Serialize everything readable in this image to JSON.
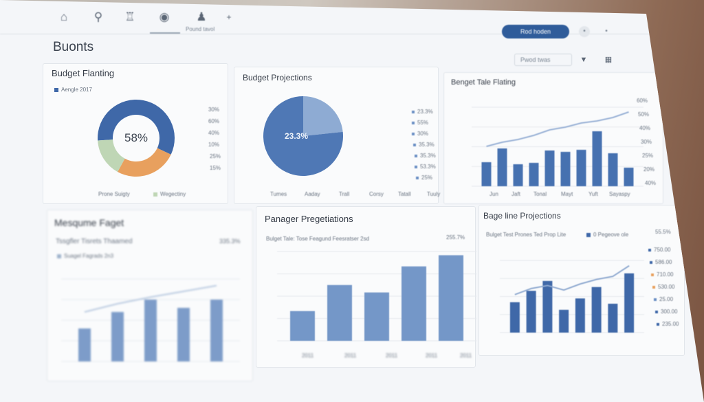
{
  "page": {
    "title": "Buonts"
  },
  "topbar": {
    "icons": [
      "home-icon",
      "search-icon",
      "users-icon",
      "dollar-icon",
      "person-icon",
      "plus-icon"
    ],
    "tab_label": "Pound tavol",
    "primary_button": "Rod hoden",
    "filter_placeholder": "Pwod twas"
  },
  "panels": {
    "budget_planning": {
      "title": "Budget Flanting",
      "legend": "Aengle 2017",
      "center_label": "58%",
      "right_labels": [
        "30%",
        "60%",
        "40%",
        "10%",
        "25%",
        "15%"
      ],
      "footer_legend": [
        "Prone Suigty",
        "Wegectiny"
      ],
      "colors": {
        "blue": "#3f68a8",
        "orange": "#e8a05e",
        "green": "#bfd6b5"
      }
    },
    "budget_projections": {
      "title": "Budget Projections",
      "center_label": "23.3%",
      "right_labels": [
        "23.3%",
        "55%",
        "30%",
        "35.3%",
        "35.3%",
        "53.3%",
        "25%"
      ],
      "x_labels": [
        "Tumes",
        "Aaday",
        "Trall",
        "Corsy",
        "Tatall",
        "Tuuly"
      ]
    },
    "budget_tale_planting": {
      "title": "Benget Tale Flating",
      "right_labels": [
        "60%",
        "50%",
        "40%",
        "30%",
        "25%",
        "20%",
        "40%"
      ],
      "x_labels": [
        "Jun",
        "Jaft",
        "Tonal",
        "Mayt",
        "Yuft",
        "Sayaspy"
      ]
    },
    "measure_target": {
      "title": "Mesqume Faget",
      "subtitle": "Tssgfler Tisrets Thaamed",
      "value": "335.3%",
      "legend": "Suagel Fagrads 2n3"
    },
    "manager_projections": {
      "title": "Panager Pregetiations",
      "subtitle": "Bulget Tale: Tose Feagund Feesratser 2sd",
      "value": "255.7%",
      "x_labels": [
        "2011",
        "2011",
        "2011",
        "2011",
        "2011"
      ]
    },
    "baseline_projections": {
      "title": "Bage line Projections",
      "subtitle": "Bulget Test Prones Ted Prop Lite",
      "legend": "0 Pegeove ole",
      "value": "55.5%",
      "right_labels": [
        "750.00",
        "586.00",
        "710.00",
        "530.00",
        "25.00",
        "300.00",
        "235.00"
      ]
    }
  },
  "chart_data": [
    {
      "type": "pie",
      "title": "Budget Flanting",
      "values": [
        58,
        26,
        16
      ],
      "colors": [
        "#3f68a8",
        "#e8a05e",
        "#bfd6b5"
      ],
      "center_label": "58%"
    },
    {
      "type": "pie",
      "title": "Budget Projections",
      "values": [
        23.3,
        76.7
      ],
      "colors": [
        "#8eabd3",
        "#4f78b5"
      ],
      "center_label": "23.3%"
    },
    {
      "type": "bar",
      "title": "Benget Tale Flating",
      "categories": [
        "Jun",
        "Jaft",
        "Tonal",
        "Mayt",
        "Yuft",
        "Sayaspy"
      ],
      "values": [
        35,
        55,
        32,
        34,
        52,
        50,
        53,
        80,
        48,
        27
      ],
      "line": [
        58,
        64,
        68,
        74,
        82,
        86,
        92,
        95,
        100,
        108
      ]
    },
    {
      "type": "bar",
      "title": "Mesqume Faget",
      "values": [
        40,
        60,
        75,
        65,
        75
      ],
      "line": [
        60,
        70,
        78,
        85,
        92
      ]
    },
    {
      "type": "bar",
      "title": "Panager Pregetiations",
      "categories": [
        "2011",
        "2011",
        "2011",
        "2011",
        "2011"
      ],
      "values": [
        40,
        75,
        65,
        100,
        115
      ]
    },
    {
      "type": "bar",
      "title": "Bage line Projections",
      "values": [
        40,
        55,
        68,
        30,
        45,
        60,
        38,
        78
      ],
      "line": [
        50,
        58,
        62,
        56,
        64,
        70,
        74,
        88
      ]
    }
  ]
}
